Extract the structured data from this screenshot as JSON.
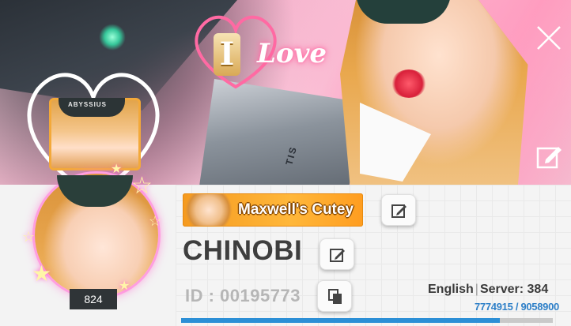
{
  "banner": {
    "love_letter": "I",
    "love_word": "Love",
    "gun_text": "TIS",
    "mini_hat_text": "ABYSSIUS"
  },
  "avatar": {
    "level": "824"
  },
  "profile": {
    "title_badge": "Maxwell's Cutey",
    "nickname": "CHINOBI",
    "id_text": "ID : 00195773",
    "language": "English",
    "server_text": "Server: 384",
    "progress_text": "7774915 / 9058900",
    "progress_fraction": 0.858
  },
  "colors": {
    "accent": "#2c8fd6",
    "badge": "#ffb73a"
  },
  "icons": {
    "close": "close-icon",
    "edit": "pencil-edit-icon",
    "copy": "copy-icon"
  }
}
